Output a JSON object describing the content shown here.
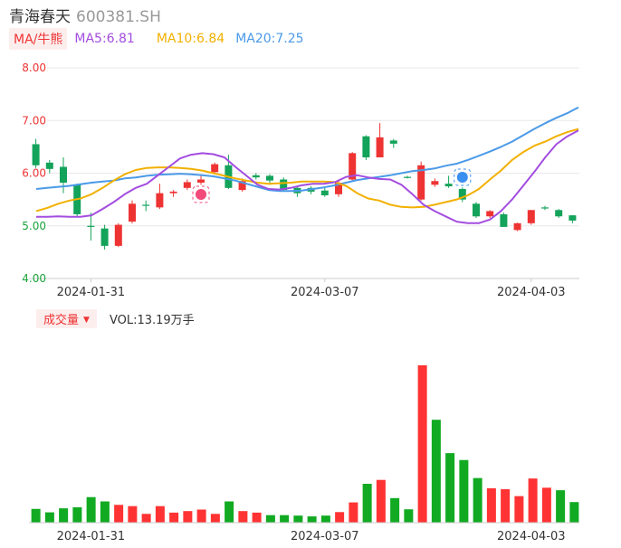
{
  "header": {
    "name": "青海春天",
    "code": "600381.SH"
  },
  "ma": {
    "button": "MA/牛熊",
    "ma5": "MA5:6.81",
    "ma10": "MA10:6.84",
    "ma20": "MA20:7.25"
  },
  "volume_header": {
    "button": "成交量",
    "value": "VOL:13.19万手"
  },
  "colors": {
    "up": "#ee3333",
    "down": "#13a35a",
    "vol_up": "#ff3333",
    "vol_down": "#11aa22",
    "ma5": "#a34de0",
    "ma10": "#f2b000",
    "ma20": "#4a9ae8"
  },
  "chart_data": [
    {
      "type": "candlestick",
      "y_ticks": [
        "8.00",
        "7.00",
        "6.00",
        "5.00",
        "4.00"
      ],
      "ylim": [
        4.0,
        8.0
      ],
      "x_ticks": [
        "2024-01-31",
        "2024-03-07",
        "2024-04-03"
      ],
      "x_tick_index": [
        4,
        21,
        36
      ],
      "candles": [
        {
          "o": 6.55,
          "c": 6.15,
          "h": 6.65,
          "l": 6.1
        },
        {
          "o": 6.2,
          "c": 6.08,
          "h": 6.25,
          "l": 6.0
        },
        {
          "o": 6.12,
          "c": 5.82,
          "h": 6.3,
          "l": 5.62
        },
        {
          "o": 5.78,
          "c": 5.22,
          "h": 5.8,
          "l": 5.18
        },
        {
          "o": 5.0,
          "c": 4.98,
          "h": 5.25,
          "l": 4.72
        },
        {
          "o": 4.95,
          "c": 4.62,
          "h": 5.02,
          "l": 4.55
        },
        {
          "o": 4.62,
          "c": 5.02,
          "h": 5.05,
          "l": 4.6
        },
        {
          "o": 5.08,
          "c": 5.42,
          "h": 5.48,
          "l": 5.05
        },
        {
          "o": 5.4,
          "c": 5.38,
          "h": 5.48,
          "l": 5.28
        },
        {
          "o": 5.35,
          "c": 5.62,
          "h": 5.8,
          "l": 5.32
        },
        {
          "o": 5.62,
          "c": 5.65,
          "h": 5.68,
          "l": 5.55
        },
        {
          "o": 5.72,
          "c": 5.83,
          "h": 5.88,
          "l": 5.68
        },
        {
          "o": 5.82,
          "c": 5.88,
          "h": 5.98,
          "l": 5.78
        },
        {
          "o": 6.02,
          "c": 6.17,
          "h": 6.2,
          "l": 5.98
        },
        {
          "o": 6.15,
          "c": 5.72,
          "h": 6.35,
          "l": 5.7
        },
        {
          "o": 5.68,
          "c": 5.85,
          "h": 5.9,
          "l": 5.65
        },
        {
          "o": 5.96,
          "c": 5.92,
          "h": 6.0,
          "l": 5.88
        },
        {
          "o": 5.95,
          "c": 5.86,
          "h": 5.98,
          "l": 5.78
        },
        {
          "o": 5.88,
          "c": 5.68,
          "h": 5.92,
          "l": 5.65
        },
        {
          "o": 5.72,
          "c": 5.62,
          "h": 5.75,
          "l": 5.55
        },
        {
          "o": 5.72,
          "c": 5.65,
          "h": 5.75,
          "l": 5.6
        },
        {
          "o": 5.67,
          "c": 5.58,
          "h": 5.72,
          "l": 5.55
        },
        {
          "o": 5.6,
          "c": 5.82,
          "h": 5.86,
          "l": 5.55
        },
        {
          "o": 5.88,
          "c": 6.38,
          "h": 6.4,
          "l": 5.86
        },
        {
          "o": 6.7,
          "c": 6.3,
          "h": 6.72,
          "l": 6.25
        },
        {
          "o": 6.3,
          "c": 6.68,
          "h": 6.95,
          "l": 6.3
        },
        {
          "o": 6.62,
          "c": 6.56,
          "h": 6.65,
          "l": 6.48
        },
        {
          "o": 5.93,
          "c": 5.92,
          "h": 5.95,
          "l": 5.9
        },
        {
          "o": 5.5,
          "c": 6.15,
          "h": 6.22,
          "l": 5.48
        },
        {
          "o": 5.78,
          "c": 5.85,
          "h": 5.9,
          "l": 5.74
        },
        {
          "o": 5.8,
          "c": 5.75,
          "h": 5.95,
          "l": 5.72
        },
        {
          "o": 5.7,
          "c": 5.5,
          "h": 5.73,
          "l": 5.45
        },
        {
          "o": 5.42,
          "c": 5.18,
          "h": 5.45,
          "l": 5.15
        },
        {
          "o": 5.18,
          "c": 5.28,
          "h": 5.3,
          "l": 5.15
        },
        {
          "o": 5.22,
          "c": 4.98,
          "h": 5.25,
          "l": 4.98
        },
        {
          "o": 4.92,
          "c": 5.05,
          "h": 5.06,
          "l": 4.9
        },
        {
          "o": 5.05,
          "c": 5.3,
          "h": 5.3,
          "l": 5.02
        },
        {
          "o": 5.35,
          "c": 5.33,
          "h": 5.38,
          "l": 5.3
        },
        {
          "o": 5.3,
          "c": 5.18,
          "h": 5.32,
          "l": 5.15
        },
        {
          "o": 5.2,
          "c": 5.1,
          "h": 5.2,
          "l": 5.05
        }
      ],
      "ma5": [
        5.17,
        5.17,
        5.18,
        5.17,
        5.17,
        5.2,
        5.32,
        5.45,
        5.6,
        5.72,
        5.8,
        5.96,
        6.12,
        6.28,
        6.35,
        6.38,
        6.36,
        6.3,
        6.12,
        5.95,
        5.78,
        5.7,
        5.69,
        5.72,
        5.77,
        5.8,
        5.8,
        5.83,
        5.93,
        5.96,
        5.92,
        5.89,
        5.88,
        5.78,
        5.6,
        5.4,
        5.28,
        5.18,
        5.08,
        5.05,
        5.05,
        5.12,
        5.28,
        5.5,
        5.76,
        6.02,
        6.3,
        6.55,
        6.7,
        6.81
      ],
      "ma10": [
        5.28,
        5.34,
        5.42,
        5.48,
        5.52,
        5.6,
        5.72,
        5.86,
        5.98,
        6.06,
        6.1,
        6.11,
        6.11,
        6.1,
        6.08,
        6.05,
        6.0,
        5.95,
        5.9,
        5.86,
        5.82,
        5.8,
        5.81,
        5.82,
        5.84,
        5.84,
        5.84,
        5.83,
        5.76,
        5.62,
        5.52,
        5.48,
        5.4,
        5.36,
        5.35,
        5.36,
        5.4,
        5.45,
        5.5,
        5.58,
        5.7,
        5.88,
        6.05,
        6.25,
        6.4,
        6.52,
        6.6,
        6.7,
        6.78,
        6.84
      ],
      "ma20": [
        5.7,
        5.72,
        5.74,
        5.76,
        5.79,
        5.82,
        5.84,
        5.86,
        5.9,
        5.92,
        5.95,
        5.97,
        5.98,
        5.99,
        5.98,
        5.96,
        5.94,
        5.9,
        5.86,
        5.8,
        5.74,
        5.68,
        5.66,
        5.66,
        5.67,
        5.7,
        5.73,
        5.77,
        5.82,
        5.87,
        5.9,
        5.93,
        5.96,
        6.0,
        6.04,
        6.06,
        6.09,
        6.14,
        6.18,
        6.25,
        6.33,
        6.41,
        6.5,
        6.6,
        6.72,
        6.84,
        6.95,
        7.05,
        7.14,
        7.25
      ],
      "signals": [
        {
          "index": 12,
          "kind": "bull"
        },
        {
          "index": 31,
          "kind": "bear"
        }
      ]
    },
    {
      "type": "bar",
      "name": "volume",
      "unit": "万手",
      "x_ticks": [
        "2024-01-31",
        "2024-03-07",
        "2024-04-03"
      ],
      "values": [
        2.08,
        1.56,
        2.17,
        2.33,
        3.86,
        3.21,
        2.69,
        2.5,
        1.33,
        2.5,
        1.52,
        1.75,
        1.98,
        1.33,
        3.21,
        1.75,
        1.52,
        1.14,
        1.14,
        1.07,
        0.95,
        1.07,
        1.6,
        3.06,
        5.87,
        6.46,
        3.71,
        2.02,
        23.76,
        15.54,
        10.5,
        9.46,
        6.74,
        5.2,
        5.05,
        4.01,
        6.67,
        5.28,
        4.9,
        3.11
      ],
      "up": [
        false,
        false,
        false,
        false,
        false,
        false,
        true,
        true,
        true,
        true,
        true,
        true,
        true,
        true,
        false,
        true,
        true,
        false,
        false,
        false,
        false,
        false,
        true,
        true,
        false,
        true,
        false,
        false,
        true,
        false,
        false,
        false,
        false,
        true,
        true,
        true,
        true,
        true,
        false,
        false
      ]
    }
  ]
}
